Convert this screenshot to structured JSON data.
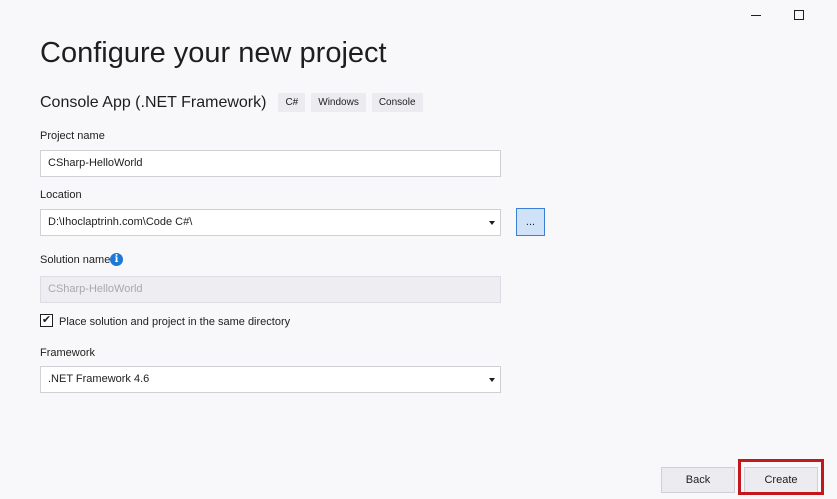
{
  "window": {
    "minimize_icon": "minimize-icon",
    "maximize_icon": "maximize-icon"
  },
  "header": {
    "title": "Configure your new project"
  },
  "template": {
    "name": "Console App (.NET Framework)",
    "tags": [
      "C#",
      "Windows",
      "Console"
    ]
  },
  "project_name": {
    "label": "Project name",
    "value": "CSharp-HelloWorld"
  },
  "location": {
    "label": "Location",
    "value": "D:\\Ihoclaptrinh.com\\Code C#\\",
    "browse_label": "..."
  },
  "solution_name": {
    "label": "Solution name",
    "value": "CSharp-HelloWorld",
    "info_glyph": "i"
  },
  "same_directory": {
    "checked": true,
    "check_glyph": "✔",
    "label": "Place solution and project in the same directory"
  },
  "framework": {
    "label": "Framework",
    "value": ".NET Framework 4.6"
  },
  "footer": {
    "back_label": "Back",
    "create_label": "Create"
  },
  "colors": {
    "accent": "#1c79d6",
    "highlight": "#c4171b",
    "background": "#f8f8fa"
  }
}
